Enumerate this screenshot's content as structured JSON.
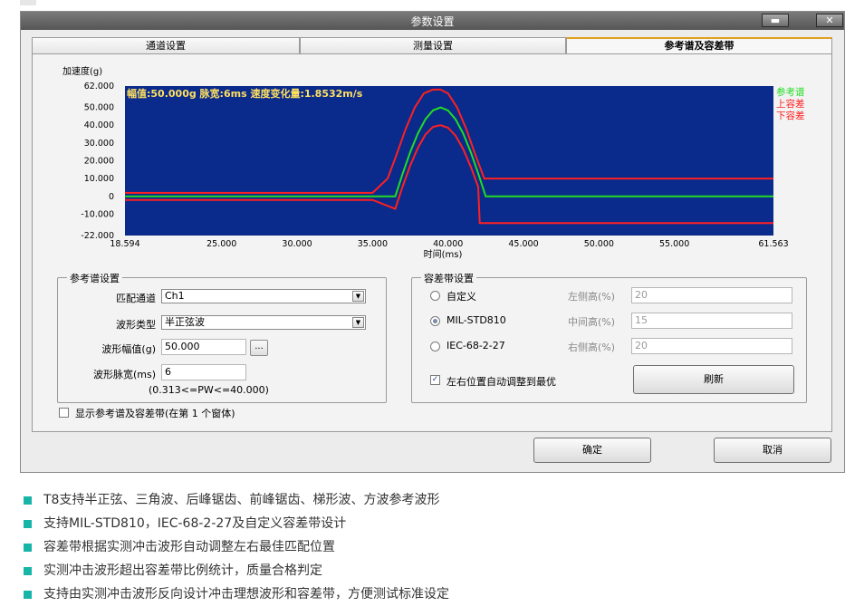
{
  "window": {
    "title": "参数设置",
    "minimize_glyph": "▬",
    "close_glyph": "✕"
  },
  "tabs": [
    {
      "label": "通道设置",
      "active": false
    },
    {
      "label": "测量设置",
      "active": false
    },
    {
      "label": "参考谱及容差带",
      "active": true
    }
  ],
  "chart_data": {
    "type": "line",
    "ylabel": "加速度(g)",
    "xlabel": "时间(ms)",
    "annotation": "幅值:50.000g  脉宽:6ms  速度变化量:1.8532m/s",
    "xlim": [
      18.594,
      61.563
    ],
    "ylim": [
      -22.0,
      62.0
    ],
    "x_ticks": [
      "18.594",
      "25.000",
      "30.000",
      "35.000",
      "40.000",
      "45.000",
      "50.000",
      "55.000",
      "61.563"
    ],
    "x_tick_values": [
      18.594,
      25,
      30,
      35,
      40,
      45,
      50,
      55,
      61.563
    ],
    "y_ticks": [
      "62.000",
      "50.000",
      "40.000",
      "30.000",
      "20.000",
      "10.000",
      "0",
      "-10.000",
      "-22.000"
    ],
    "y_tick_values": [
      62,
      50,
      40,
      30,
      20,
      10,
      0,
      -10,
      -22
    ],
    "background": "#0a2a8c",
    "grid": false,
    "legend_position": "right",
    "series": [
      {
        "name": "参考谱",
        "color": "#22dd22",
        "x": [
          18.594,
          36.5,
          37.0,
          37.5,
          38.0,
          38.5,
          39.0,
          39.5,
          40.0,
          40.5,
          41.0,
          41.5,
          42.0,
          42.5,
          61.563
        ],
        "y": [
          0,
          0,
          12.94,
          25.0,
          35.36,
          43.3,
          48.3,
          50.0,
          48.3,
          43.3,
          35.36,
          25.0,
          12.94,
          0,
          0
        ]
      },
      {
        "name": "上容差",
        "color": "#ff2020",
        "x": [
          18.594,
          35.0,
          36.0,
          36.6,
          37.2,
          37.8,
          38.4,
          39.0,
          39.5,
          40.0,
          40.6,
          41.2,
          41.8,
          42.4,
          43.0,
          61.563
        ],
        "y": [
          2.0,
          2.0,
          10.0,
          23.6,
          38.0,
          50.0,
          57.9,
          60.0,
          60.0,
          57.9,
          50.0,
          38.0,
          23.6,
          10.0,
          10.0,
          10.0
        ]
      },
      {
        "name": "下容差",
        "color": "#ff2020",
        "x": [
          18.594,
          35.0,
          36.5,
          37.0,
          37.5,
          38.0,
          38.5,
          39.0,
          39.5,
          40.0,
          40.5,
          41.0,
          41.5,
          42.0,
          42.1,
          61.563
        ],
        "y": [
          -2.0,
          -2.0,
          -7.0,
          5.7,
          17.4,
          27.3,
          34.7,
          39.0,
          40.0,
          38.6,
          34.1,
          26.6,
          16.8,
          5.4,
          -15.0,
          -15.0
        ]
      }
    ]
  },
  "ref_group": {
    "title": "参考谱设置",
    "channel_label": "匹配通道",
    "channel_value": "Ch1",
    "wave_label": "波形类型",
    "wave_value": "半正弦波",
    "amp_label": "波形幅值(g)",
    "amp_value": "50.000",
    "amp_btn": "...",
    "pw_label": "波形脉宽(ms)",
    "pw_value": "6",
    "pw_range": "(0.313<=PW<=40.000)"
  },
  "show_checkbox_label": "显示参考谱及容差带(在第 1 个窗体)",
  "tol_group": {
    "title": "容差带设置",
    "options": [
      {
        "label": "自定义",
        "selected": false,
        "field_label": "左侧高(%)",
        "field_value": "20"
      },
      {
        "label": "MIL-STD810",
        "selected": true,
        "field_label": "中间高(%)",
        "field_value": "15"
      },
      {
        "label": "IEC-68-2-27",
        "selected": false,
        "field_label": "右侧高(%)",
        "field_value": "20"
      }
    ],
    "auto_label": "左右位置自动调整到最优",
    "auto_checked": true,
    "refresh_label": "刷新"
  },
  "footer": {
    "ok_label": "确定",
    "cancel_label": "取消"
  },
  "bullets": [
    "T8支持半正弦、三角波、后峰锯齿、前峰锯齿、梯形波、方波参考波形",
    "支持MIL-STD810，IEC-68-2-27及自定义容差带设计",
    "容差带根据实测冲击波形自动调整左右最佳匹配位置",
    "实测冲击波形超出容差带比例统计，质量合格判定",
    "支持由实测冲击波形反向设计冲击理想波形和容差带，方便测试标准设定"
  ],
  "colors": {
    "accent_bullet": "#17b4a8",
    "active_tab_top": "#e0a020",
    "annotation_text": "#ffe060"
  }
}
